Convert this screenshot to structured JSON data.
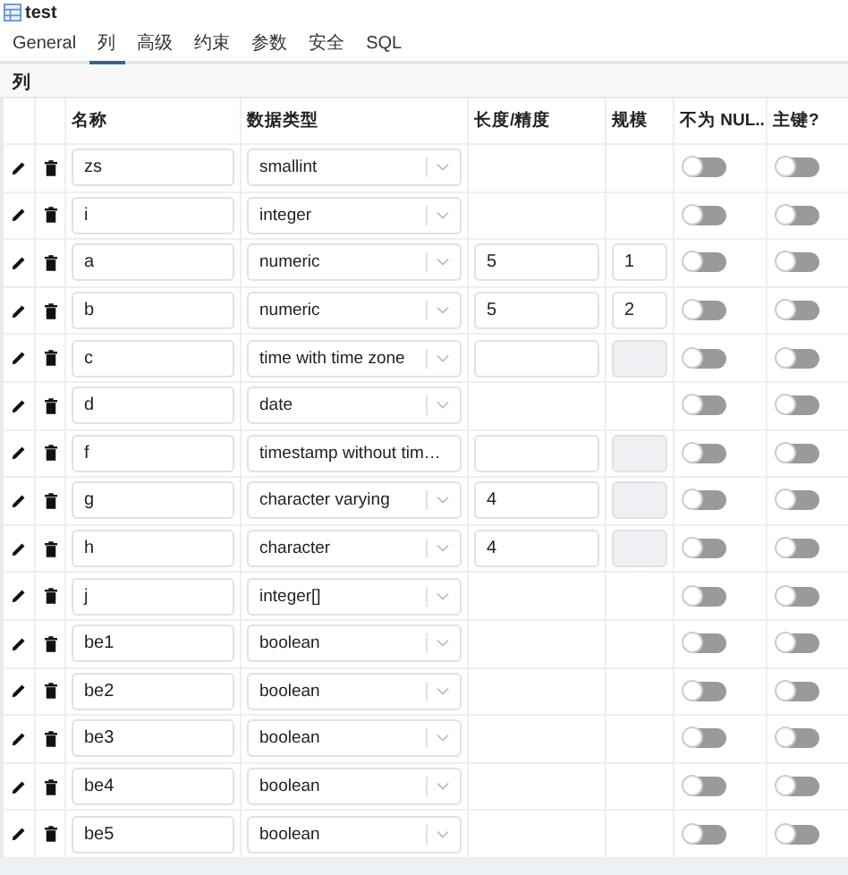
{
  "window": {
    "title": "test"
  },
  "tabs": [
    {
      "label": "General",
      "selected": false
    },
    {
      "label": "列",
      "selected": true
    },
    {
      "label": "高级",
      "selected": false
    },
    {
      "label": "约束",
      "selected": false
    },
    {
      "label": "参数",
      "selected": false
    },
    {
      "label": "安全",
      "selected": false
    },
    {
      "label": "SQL",
      "selected": false
    }
  ],
  "section": {
    "title": "列"
  },
  "table": {
    "columns": [
      "名称",
      "数据类型",
      "长度/精度",
      "规模",
      "不为 NUL...",
      "主键?"
    ],
    "rows": [
      {
        "name": "zs",
        "type": "smallint",
        "not_null": false,
        "primary_key": false
      },
      {
        "name": "i",
        "type": "integer",
        "not_null": false,
        "primary_key": false
      },
      {
        "name": "a",
        "type": "numeric",
        "length": {
          "kind": "input",
          "value": "5"
        },
        "scale": {
          "kind": "input",
          "value": "1"
        },
        "not_null": false,
        "primary_key": false
      },
      {
        "name": "b",
        "type": "numeric",
        "length": {
          "kind": "input",
          "value": "5"
        },
        "scale": {
          "kind": "input",
          "value": "2"
        },
        "not_null": false,
        "primary_key": false
      },
      {
        "name": "c",
        "type": "time with time zone",
        "length": {
          "kind": "input"
        },
        "scale": {
          "kind": "disabled"
        },
        "not_null": false,
        "primary_key": false
      },
      {
        "name": "d",
        "type": "date",
        "not_null": false,
        "primary_key": false
      },
      {
        "name": "f",
        "type": "timestamp without tim…",
        "length": {
          "kind": "input"
        },
        "scale": {
          "kind": "disabled"
        },
        "not_null": false,
        "primary_key": false
      },
      {
        "name": "g",
        "type": "character varying",
        "length": {
          "kind": "input",
          "value": "4"
        },
        "scale": {
          "kind": "disabled"
        },
        "not_null": false,
        "primary_key": false
      },
      {
        "name": "h",
        "type": "character",
        "length": {
          "kind": "input",
          "value": "4"
        },
        "scale": {
          "kind": "disabled"
        },
        "not_null": false,
        "primary_key": false
      },
      {
        "name": "j",
        "type": "integer[]",
        "not_null": false,
        "primary_key": false
      },
      {
        "name": "be1",
        "type": "boolean",
        "not_null": false,
        "primary_key": false
      },
      {
        "name": "be2",
        "type": "boolean",
        "not_null": false,
        "primary_key": false
      },
      {
        "name": "be3",
        "type": "boolean",
        "not_null": false,
        "primary_key": false
      },
      {
        "name": "be4",
        "type": "boolean",
        "not_null": false,
        "primary_key": false
      },
      {
        "name": "be5",
        "type": "boolean",
        "not_null": false,
        "primary_key": false
      }
    ]
  }
}
